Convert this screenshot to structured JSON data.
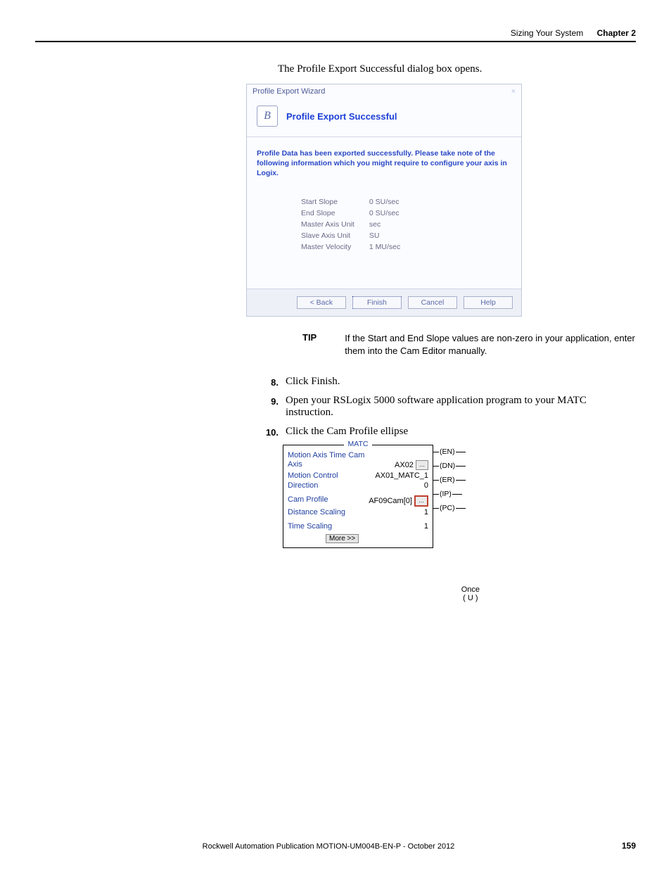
{
  "header": {
    "section": "Sizing Your System",
    "chapter": "Chapter 2"
  },
  "intro": "The Profile Export Successful dialog box opens.",
  "dialog": {
    "window_title": "Profile Export Wizard",
    "close_glyph": "×",
    "icon_glyph": "B",
    "banner_title": "Profile Export Successful",
    "message": "Profile Data has been exported successfully. Please take note of the following information which you might require to configure your axis in Logix.",
    "rows": [
      {
        "label": "Start Slope",
        "value": "0 SU/sec"
      },
      {
        "label": "End Slope",
        "value": "0 SU/sec"
      },
      {
        "label": "Master Axis Unit",
        "value": "sec"
      },
      {
        "label": "Slave Axis Unit",
        "value": "SU"
      },
      {
        "label": "Master Velocity",
        "value": "1 MU/sec"
      }
    ],
    "buttons": {
      "back": "< Back",
      "finish": "Finish",
      "cancel": "Cancel",
      "help": "Help"
    }
  },
  "tip": {
    "label": "TIP",
    "text": "If the Start and End Slope values are non-zero in your application, enter them into the Cam Editor manually."
  },
  "steps": {
    "s8": {
      "num": "8.",
      "text": "Click Finish."
    },
    "s9": {
      "num": "9.",
      "text": "Open your RSLogix 5000 software application program to your MATC instruction."
    },
    "s10": {
      "num": "10.",
      "text": "Click the Cam Profile ellipse"
    }
  },
  "ladder": {
    "title": "MATC",
    "desc": "Motion Axis Time Cam",
    "rows": {
      "axis_l": "Axis",
      "axis_v": "AX02",
      "mc_l": "Motion Control",
      "mc_v": "AX01_MATC_1",
      "dir_l": "Direction",
      "dir_v": "0",
      "cam_l": "Cam Profile",
      "cam_v": "AF09Cam[0]",
      "ds_l": "Distance Scaling",
      "ds_v": "1",
      "ts_l": "Time Scaling",
      "ts_v": "1"
    },
    "more": "More >>",
    "ellipsis": "...",
    "outputs": {
      "en": "(EN)",
      "dn": "(DN)",
      "er": "(ER)",
      "ip": "(IP)",
      "pc": "(PC)"
    },
    "once": "Once",
    "once_coil": "( U )"
  },
  "footer": {
    "publication": "Rockwell Automation Publication MOTION-UM004B-EN-P - October 2012",
    "page": "159"
  }
}
